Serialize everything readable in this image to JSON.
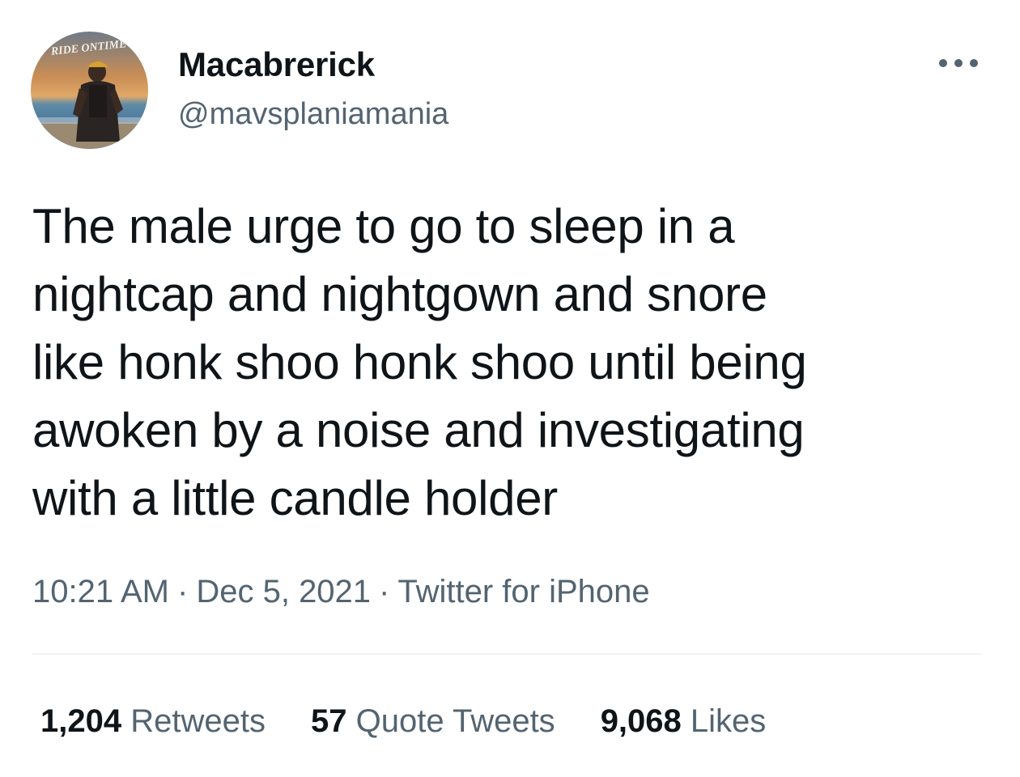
{
  "user": {
    "display_name": "Macabrerick",
    "handle": "@mavsplaniamania",
    "avatar_caption": "RIDE ONTIME"
  },
  "tweet": {
    "text": "The male urge to go to sleep in a\nnightcap and nightgown and snore\nlike honk shoo honk shoo until being\nawoken by a noise and investigating\nwith a little candle holder",
    "time": "10:21 AM",
    "date": "Dec 5, 2021",
    "source": "Twitter for iPhone",
    "separator": "·"
  },
  "stats": {
    "retweets": {
      "count": "1,204",
      "label": "Retweets"
    },
    "quote_tweets": {
      "count": "57",
      "label": "Quote Tweets"
    },
    "likes": {
      "count": "9,068",
      "label": "Likes"
    }
  },
  "icons": {
    "more": "more-horizontal-icon"
  },
  "colors": {
    "text_primary": "#0f1419",
    "text_secondary": "#536471",
    "divider": "#eff3f4"
  }
}
